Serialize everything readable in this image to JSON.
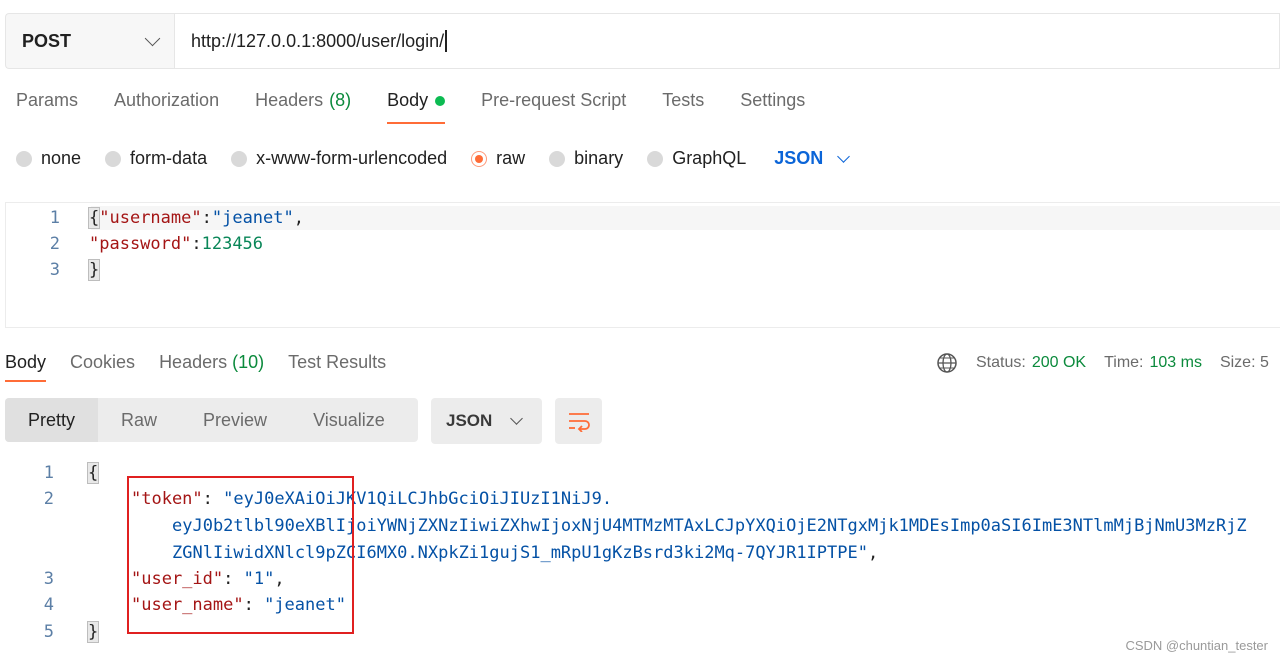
{
  "request": {
    "method": "POST",
    "url": "http://127.0.0.1:8000/user/login/",
    "tabs": [
      {
        "label": "Params"
      },
      {
        "label": "Authorization"
      },
      {
        "label": "Headers",
        "count": "(8)"
      },
      {
        "label": "Body"
      },
      {
        "label": "Pre-request Script"
      },
      {
        "label": "Tests"
      },
      {
        "label": "Settings"
      }
    ],
    "body_types": [
      "none",
      "form-data",
      "x-www-form-urlencoded",
      "raw",
      "binary",
      "GraphQL"
    ],
    "selected_body_type": "raw",
    "format": "JSON",
    "line_numbers": [
      "1",
      "2",
      "3"
    ],
    "code": {
      "l1_open": "{",
      "l1_key": "\"username\"",
      "l1_colon": ":",
      "l1_val": "\"jeanet\"",
      "l1_comma": ",",
      "l2_key": "\"password\"",
      "l2_colon": ":",
      "l2_val": "123456",
      "l3_close": "}"
    }
  },
  "response": {
    "tabs": [
      {
        "label": "Body"
      },
      {
        "label": "Cookies"
      },
      {
        "label": "Headers",
        "count": "(10)"
      },
      {
        "label": "Test Results"
      }
    ],
    "status_label": "Status:",
    "status_value": "200 OK",
    "time_label": "Time:",
    "time_value": "103 ms",
    "size_label": "Size: 5",
    "views": [
      "Pretty",
      "Raw",
      "Preview",
      "Visualize"
    ],
    "format": "JSON",
    "line_numbers": [
      "1",
      "2",
      "3",
      "4",
      "5"
    ],
    "code": {
      "open": "{",
      "token_key": "\"token\"",
      "token_line1": "\"eyJ0eXAiOiJKV1QiLCJhbGciOiJIUzI1NiJ9.",
      "token_line2": "eyJ0b2tlbl90eXBlIjoiYWNjZXNzIiwiZXhwIjoxNjU4MTMzMTAxLCJpYXQiOjE2NTgxMjk1MDEsImp0aSI6ImE3NTlmMjBjNmU3MzRjZ",
      "token_line3": "ZGNlIiwidXNlcl9pZCI6MX0.NXpkZi1gujS1_mRpU1gKzBsrd3ki2Mq-7QYJR1IPTPE\"",
      "user_id_key": "\"user_id\"",
      "user_id_val": "\"1\"",
      "user_name_key": "\"user_name\"",
      "user_name_val": "\"jeanet\"",
      "close": "}",
      "colon": ": ",
      "comma": ","
    }
  },
  "watermark": "CSDN @chuntian_tester",
  "colors": {
    "accent": "#ff6c37",
    "success": "#0b8a3c",
    "link": "#0b65d8",
    "highlight_box": "#e02020"
  }
}
